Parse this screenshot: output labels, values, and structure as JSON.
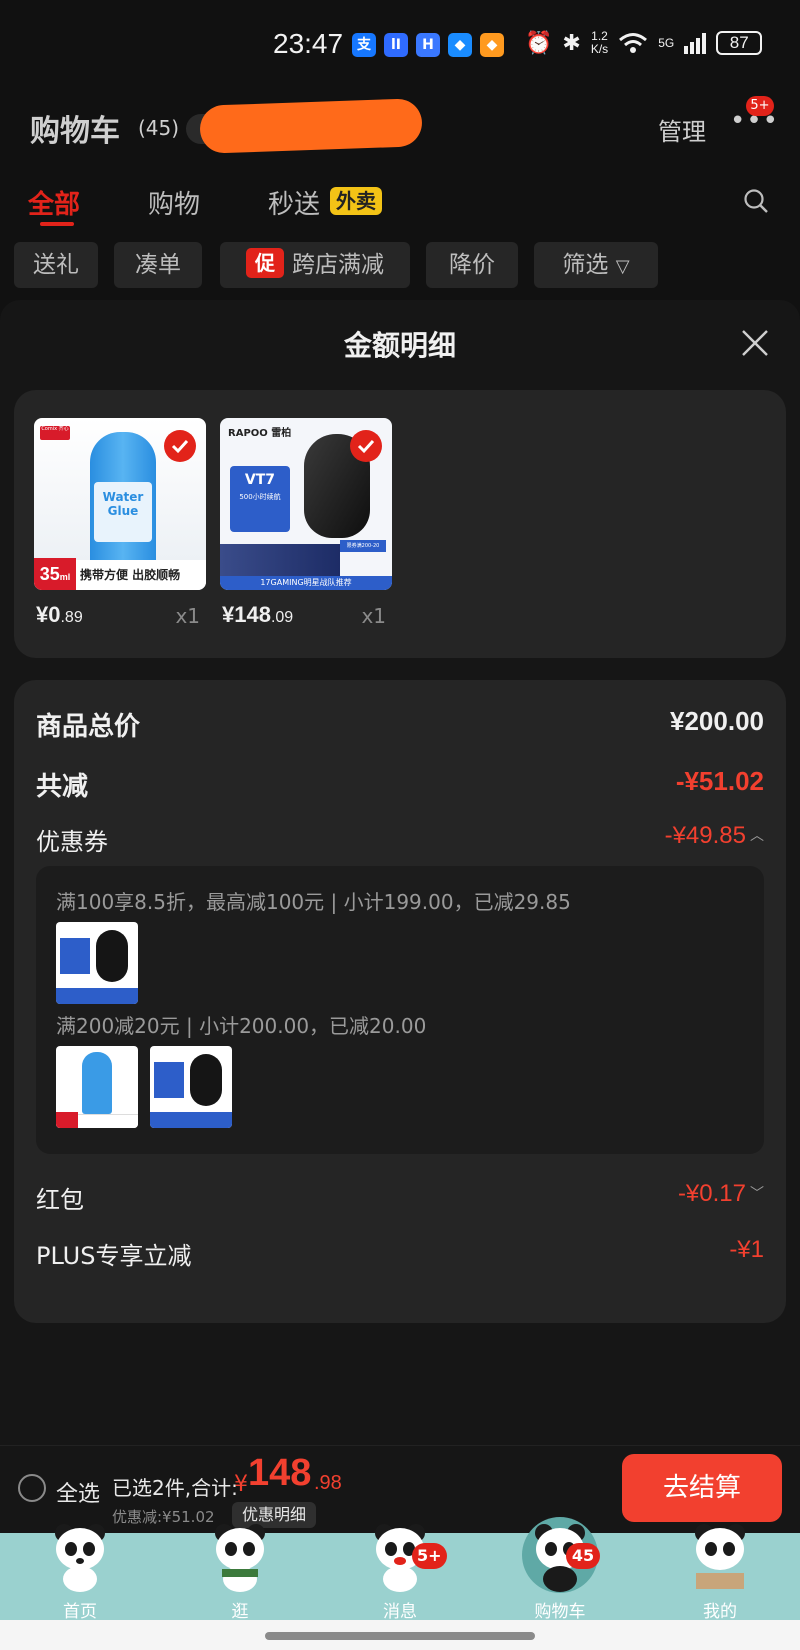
{
  "status_bar": {
    "time": "23:47",
    "app_icons": [
      "支",
      "lI",
      "H",
      "◆",
      "◆"
    ],
    "net_speed_top": "1.2",
    "net_speed_unit": "K/s",
    "network": "5G",
    "battery": "87"
  },
  "header": {
    "title": "购物车",
    "count": "(45)",
    "manage": "管理",
    "more_badge": "5+"
  },
  "tabs": [
    {
      "label": "全部",
      "active": true
    },
    {
      "label": "购物",
      "active": false
    },
    {
      "label": "秒送",
      "active": false
    }
  ],
  "tab_badge": "外卖",
  "filters": [
    {
      "label": "送礼"
    },
    {
      "label": "凑单"
    },
    {
      "label": "跨店满减",
      "promo": "促"
    },
    {
      "label": "降价"
    },
    {
      "label": "筛选"
    }
  ],
  "sheet": {
    "title": "金额明细"
  },
  "products": [
    {
      "price_int": "¥0",
      "price_dec": ".89",
      "qty": "x1",
      "brand": "Comix 齐心",
      "name": "Water Glue",
      "volume": "35",
      "volume_unit": "ml",
      "tagline": "携带方便 出胶顺畅"
    },
    {
      "price_int": "¥148",
      "price_dec": ".09",
      "qty": "x1",
      "brand": "RAPOO 雷柏",
      "model": "VT7",
      "spec": "500小时续航",
      "deal": "限券满200-20",
      "team": "17GAMING明星战队推荐"
    }
  ],
  "summary": {
    "goods_total_label": "商品总价",
    "goods_total": "¥200.00",
    "reduce_label": "共减",
    "reduce": "-¥51.02",
    "coupon_label": "优惠券",
    "coupon": "-¥49.85",
    "coupon_details": [
      {
        "text": "满100享8.5折，最高减100元 | 小计199.00，已减29.85"
      },
      {
        "text": "满200减20元 | 小计200.00，已减20.00"
      }
    ],
    "redpacket_label": "红包",
    "redpacket": "-¥0.17",
    "plus_label": "PLUS专享立减",
    "plus": "-¥1"
  },
  "bottom_bar": {
    "select_all": "全选",
    "selected_summary": "已选2件,合计:",
    "currency": "¥",
    "total_int": "148",
    "total_dec": ".98",
    "saved": "优惠减:¥51.02",
    "detail": "优惠明细",
    "checkout": "去结算"
  },
  "nav": [
    {
      "label": "首页",
      "badge": ""
    },
    {
      "label": "逛",
      "badge": ""
    },
    {
      "label": "消息",
      "badge": "5+"
    },
    {
      "label": "购物车",
      "badge": "45"
    },
    {
      "label": "我的",
      "badge": ""
    }
  ],
  "colors": {
    "accent": "#e2231a",
    "price_red": "#f2402f",
    "nav_bg": "#9ad1cf",
    "coupon_yellow": "#f3c316"
  }
}
